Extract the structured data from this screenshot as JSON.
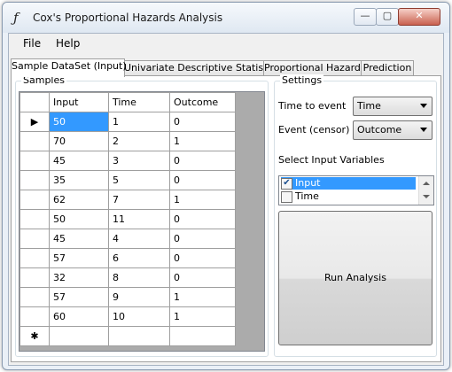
{
  "window": {
    "title": "Cox's Proportional Hazards Analysis",
    "app_icon": "ƒ"
  },
  "controls": {
    "minimize": "—",
    "maximize": "▢",
    "close": "✕"
  },
  "menu": [
    "File",
    "Help"
  ],
  "tabs": [
    {
      "label": "Sample DataSet (Input)",
      "active": true
    },
    {
      "label": "Univariate Descriptive Statistics",
      "active": false
    },
    {
      "label": "Proportional Hazards",
      "active": false
    },
    {
      "label": "Prediction",
      "active": false
    }
  ],
  "samples": {
    "title": "Samples",
    "current_row_marker": "▶",
    "new_row_marker": "✱",
    "columns": [
      "Input",
      "Time",
      "Outcome"
    ],
    "rows": [
      [
        "50",
        "1",
        "0"
      ],
      [
        "70",
        "2",
        "1"
      ],
      [
        "45",
        "3",
        "0"
      ],
      [
        "35",
        "5",
        "0"
      ],
      [
        "62",
        "7",
        "1"
      ],
      [
        "50",
        "11",
        "0"
      ],
      [
        "45",
        "4",
        "0"
      ],
      [
        "57",
        "6",
        "0"
      ],
      [
        "32",
        "8",
        "0"
      ],
      [
        "57",
        "9",
        "1"
      ],
      [
        "60",
        "10",
        "1"
      ]
    ]
  },
  "settings": {
    "title": "Settings",
    "time_label": "Time to event",
    "time_value": "Time",
    "event_label": "Event (censor)",
    "event_value": "Outcome",
    "select_label": "Select Input Variables",
    "variables": [
      {
        "name": "Input",
        "checked": true,
        "check_mark": "✔"
      },
      {
        "name": "Time",
        "checked": false,
        "check_mark": ""
      }
    ]
  },
  "run_button": "Run Analysis"
}
